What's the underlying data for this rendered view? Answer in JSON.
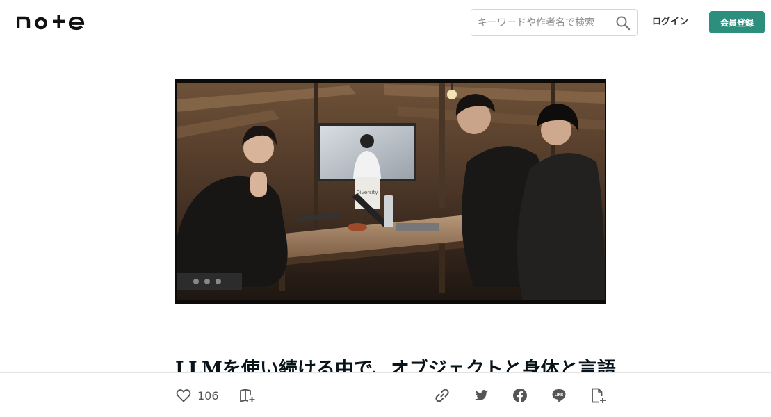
{
  "header": {
    "logo_text": "note",
    "search_placeholder": "キーワードや作者名で検索",
    "login_label": "ログイン",
    "signup_label": "会員登録",
    "accent_color": "#2c8f7e"
  },
  "hero": {
    "sign_text": "Diversity"
  },
  "article": {
    "title": "LLMを使い続ける中で、オブジェクトと身体と言語"
  },
  "footer_bar": {
    "like_count": "106",
    "icons": [
      "heart-icon",
      "magazine-add-icon",
      "link-icon",
      "twitter-icon",
      "facebook-icon",
      "line-icon",
      "note-add-icon"
    ],
    "line_text": "LINE"
  }
}
